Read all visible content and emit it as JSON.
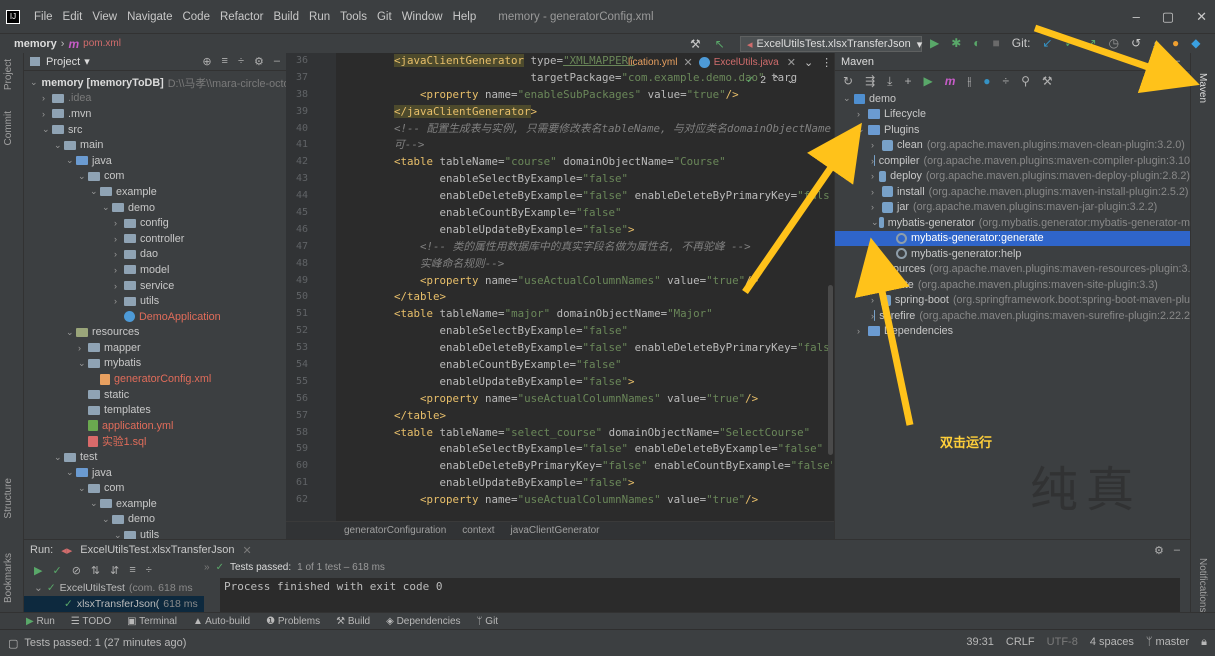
{
  "window": {
    "menu": [
      "File",
      "Edit",
      "View",
      "Navigate",
      "Code",
      "Refactor",
      "Build",
      "Run",
      "Tools",
      "Git",
      "Window",
      "Help"
    ],
    "title": "memory - generatorConfig.xml",
    "controls": [
      "–",
      "▢",
      "✕"
    ]
  },
  "breadcrumb": {
    "project": "memory",
    "sep": "›",
    "module_icon": "m",
    "file": "pom.xml"
  },
  "toolbar": {
    "run_config": "ExcelUtilsTest.xlsxTransferJson",
    "git_label": "Git:"
  },
  "left_stripe": {
    "project": "Project",
    "commit": "Commit",
    "structure": "Structure",
    "bookmarks": "Bookmarks"
  },
  "right_stripe": {
    "maven": "Maven",
    "notifications": "Notifications"
  },
  "project_panel": {
    "title": "Project",
    "root_name": "memory [memoryToDB]",
    "root_path": "D:\\\\马孝\\\\mara-circle-octo",
    "tree": [
      {
        "depth": 1,
        "arrow": "›",
        "icon": "folder",
        "label": ".idea",
        "style": "dim"
      },
      {
        "depth": 1,
        "arrow": "›",
        "icon": "folder",
        "label": ".mvn",
        "style": ""
      },
      {
        "depth": 1,
        "arrow": "⌄",
        "icon": "folder",
        "label": "src",
        "style": ""
      },
      {
        "depth": 2,
        "arrow": "⌄",
        "icon": "folder",
        "label": "main",
        "style": ""
      },
      {
        "depth": 3,
        "arrow": "⌄",
        "icon": "folder-blue",
        "label": "java",
        "style": ""
      },
      {
        "depth": 4,
        "arrow": "⌄",
        "icon": "folder",
        "label": "com",
        "style": ""
      },
      {
        "depth": 5,
        "arrow": "⌄",
        "icon": "folder",
        "label": "example",
        "style": ""
      },
      {
        "depth": 6,
        "arrow": "⌄",
        "icon": "folder",
        "label": "demo",
        "style": ""
      },
      {
        "depth": 7,
        "arrow": "›",
        "icon": "folder",
        "label": "config",
        "style": ""
      },
      {
        "depth": 7,
        "arrow": "›",
        "icon": "folder",
        "label": "controller",
        "style": ""
      },
      {
        "depth": 7,
        "arrow": "›",
        "icon": "folder",
        "label": "dao",
        "style": ""
      },
      {
        "depth": 7,
        "arrow": "›",
        "icon": "folder",
        "label": "model",
        "style": ""
      },
      {
        "depth": 7,
        "arrow": "›",
        "icon": "folder",
        "label": "service",
        "style": ""
      },
      {
        "depth": 7,
        "arrow": "›",
        "icon": "folder",
        "label": "utils",
        "style": ""
      },
      {
        "depth": 7,
        "arrow": "",
        "icon": "class",
        "label": "DemoApplication",
        "style": "red"
      },
      {
        "depth": 3,
        "arrow": "⌄",
        "icon": "folder-res",
        "label": "resources",
        "style": ""
      },
      {
        "depth": 4,
        "arrow": "›",
        "icon": "folder",
        "label": "mapper",
        "style": ""
      },
      {
        "depth": 4,
        "arrow": "⌄",
        "icon": "folder",
        "label": "mybatis",
        "style": ""
      },
      {
        "depth": 5,
        "arrow": "",
        "icon": "xml",
        "label": "generatorConfig.xml",
        "style": "red"
      },
      {
        "depth": 4,
        "arrow": "",
        "icon": "folder",
        "label": "static",
        "style": ""
      },
      {
        "depth": 4,
        "arrow": "",
        "icon": "folder",
        "label": "templates",
        "style": ""
      },
      {
        "depth": 4,
        "arrow": "",
        "icon": "yml",
        "label": "application.yml",
        "style": "red"
      },
      {
        "depth": 4,
        "arrow": "",
        "icon": "sql",
        "label": "实验1.sql",
        "style": "red"
      },
      {
        "depth": 2,
        "arrow": "⌄",
        "icon": "folder",
        "label": "test",
        "style": ""
      },
      {
        "depth": 3,
        "arrow": "⌄",
        "icon": "folder-blue",
        "label": "java",
        "style": ""
      },
      {
        "depth": 4,
        "arrow": "⌄",
        "icon": "folder",
        "label": "com",
        "style": ""
      },
      {
        "depth": 5,
        "arrow": "⌄",
        "icon": "folder",
        "label": "example",
        "style": ""
      },
      {
        "depth": 6,
        "arrow": "⌄",
        "icon": "folder",
        "label": "demo",
        "style": ""
      },
      {
        "depth": 7,
        "arrow": "⌄",
        "icon": "folder",
        "label": "utils",
        "style": ""
      }
    ]
  },
  "editor": {
    "tabs": [
      "lication.yml",
      "ExcelUtils.java"
    ],
    "match_count": "2",
    "line_numbers": [
      "36",
      "37",
      "38",
      "39",
      "40",
      "41",
      "42",
      "43",
      "44",
      "45",
      "46",
      "47",
      "48",
      "49",
      "50",
      "51",
      "52",
      "53",
      "54",
      "55",
      "56",
      "57",
      "58",
      "59",
      "60",
      "61",
      "62"
    ],
    "breadcrumbs": [
      "generatorConfiguration",
      "context",
      "javaClientGenerator"
    ]
  },
  "maven": {
    "title": "Maven",
    "tree": [
      {
        "depth": 0,
        "arrow": "⌄",
        "icon": "mvn",
        "label": "demo",
        "gray": "",
        "selected": false
      },
      {
        "depth": 1,
        "arrow": "›",
        "icon": "lifecycle",
        "label": "Lifecycle",
        "gray": "",
        "selected": false
      },
      {
        "depth": 1,
        "arrow": "⌄",
        "icon": "lifecycle",
        "label": "Plugins",
        "gray": "",
        "selected": false
      },
      {
        "depth": 2,
        "arrow": "›",
        "icon": "plug",
        "label": "clean",
        "gray": "(org.apache.maven.plugins:maven-clean-plugin:3.2.0)",
        "selected": false
      },
      {
        "depth": 2,
        "arrow": "›",
        "icon": "plug",
        "label": "compiler",
        "gray": "(org.apache.maven.plugins:maven-compiler-plugin:3.10",
        "selected": false
      },
      {
        "depth": 2,
        "arrow": "›",
        "icon": "plug",
        "label": "deploy",
        "gray": "(org.apache.maven.plugins:maven-deploy-plugin:2.8.2)",
        "selected": false
      },
      {
        "depth": 2,
        "arrow": "›",
        "icon": "plug",
        "label": "install",
        "gray": "(org.apache.maven.plugins:maven-install-plugin:2.5.2)",
        "selected": false
      },
      {
        "depth": 2,
        "arrow": "›",
        "icon": "plug",
        "label": "jar",
        "gray": "(org.apache.maven.plugins:maven-jar-plugin:3.2.2)",
        "selected": false
      },
      {
        "depth": 2,
        "arrow": "⌄",
        "icon": "plug",
        "label": "mybatis-generator",
        "gray": "(org.mybatis.generator:mybatis-generator-m",
        "selected": false
      },
      {
        "depth": 3,
        "arrow": "",
        "icon": "gear",
        "label": "mybatis-generator:generate",
        "gray": "",
        "selected": true
      },
      {
        "depth": 3,
        "arrow": "",
        "icon": "gear",
        "label": "mybatis-generator:help",
        "gray": "",
        "selected": false
      },
      {
        "depth": 2,
        "arrow": "›",
        "icon": "plug",
        "label": "resources",
        "gray": "(org.apache.maven.plugins:maven-resources-plugin:3.",
        "selected": false
      },
      {
        "depth": 2,
        "arrow": "›",
        "icon": "plug",
        "label": "site",
        "gray": "(org.apache.maven.plugins:maven-site-plugin:3.3)",
        "selected": false
      },
      {
        "depth": 2,
        "arrow": "›",
        "icon": "plug",
        "label": "spring-boot",
        "gray": "(org.springframework.boot:spring-boot-maven-plu",
        "selected": false
      },
      {
        "depth": 2,
        "arrow": "›",
        "icon": "plug",
        "label": "surefire",
        "gray": "(org.apache.maven.plugins:maven-surefire-plugin:2.22.2",
        "selected": false
      },
      {
        "depth": 1,
        "arrow": "›",
        "icon": "lifecycle",
        "label": "Dependencies",
        "gray": "",
        "selected": false
      }
    ]
  },
  "run_panel": {
    "label": "Run:",
    "tab": "ExcelUtilsTest.xlsxTransferJson",
    "tests_passed": "Tests passed:",
    "tests_detail": "1 of 1 test – 618 ms",
    "tree_root": "ExcelUtilsTest",
    "tree_root_detail": "(com. 618 ms",
    "tree_child": "xlsxTransferJson(",
    "tree_child_detail": "618 ms",
    "output": "Process finished with exit code 0"
  },
  "bottom_tools": [
    "Run",
    "TODO",
    "Terminal",
    "Auto-build",
    "Problems",
    "Build",
    "Dependencies",
    "Git"
  ],
  "status": {
    "message": "Tests passed: 1 (27 minutes ago)",
    "position": "39:31",
    "line_sep": "CRLF",
    "encoding": "UTF-8",
    "indent": "4 spaces",
    "branch": "master"
  },
  "annotation": {
    "text": "双击运行",
    "watermark": "纯真",
    "color": "#ffc21a"
  }
}
